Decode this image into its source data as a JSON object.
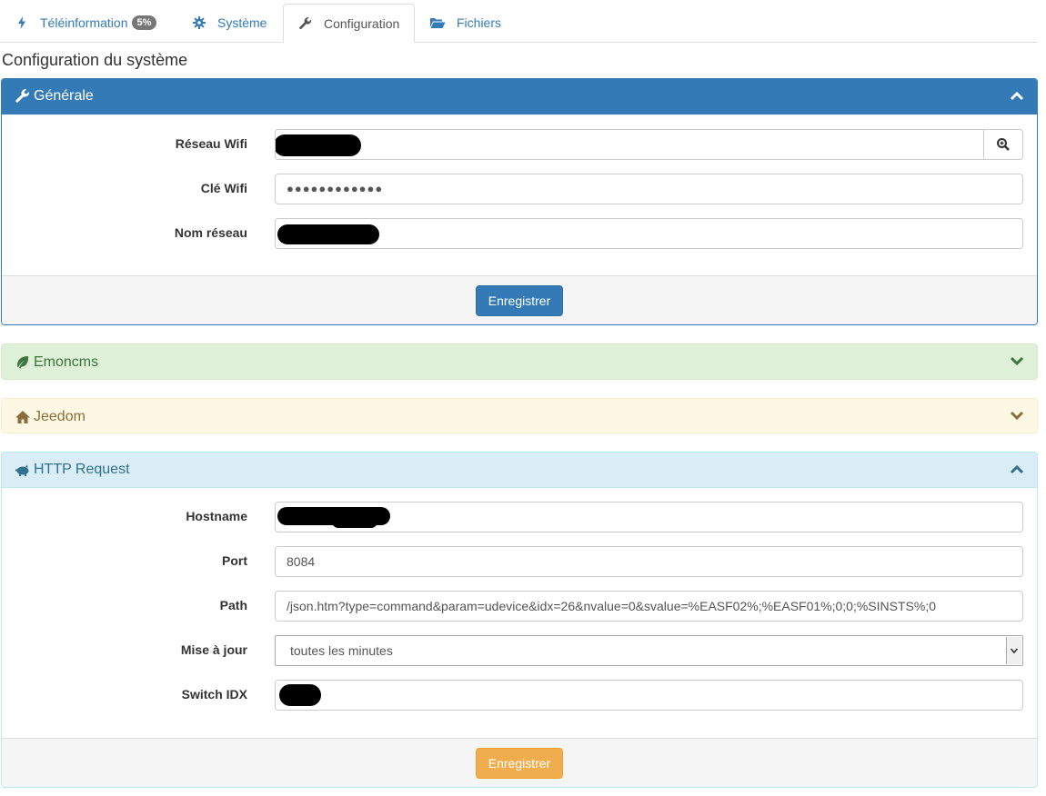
{
  "tabs": [
    {
      "label": "Téléinformation",
      "badge": "5%",
      "icon": "bolt-icon"
    },
    {
      "label": "Système",
      "icon": "gear-icon"
    },
    {
      "label": "Configuration",
      "icon": "wrench-icon",
      "active": true
    },
    {
      "label": "Fichiers",
      "icon": "folder-open-icon"
    }
  ],
  "page_title": "Configuration du système",
  "general": {
    "title": "Générale",
    "wifi_label": "Réseau Wifi",
    "key_label": "Clé Wifi",
    "key_value": "●●●●●●●●●●●●",
    "netname_label": "Nom réseau",
    "save_label": "Enregistrer"
  },
  "emoncms": {
    "title": "Emoncms"
  },
  "jeedom": {
    "title": "Jeedom"
  },
  "http": {
    "title": "HTTP Request",
    "hostname_label": "Hostname",
    "port_label": "Port",
    "port_value": "8084",
    "path_label": "Path",
    "path_value": "/json.htm?type=command&param=udevice&idx=26&nvalue=0&svalue=%EASF02%;%EASF01%;0;0;%SINSTS%;0",
    "update_label": "Mise à jour",
    "update_value": "toutes les minutes",
    "switch_label": "Switch IDX",
    "save_label": "Enregistrer"
  },
  "colors": {
    "primary": "#337ab7",
    "success": "#dff0d8",
    "warning": "#fcf8e3",
    "info": "#d9edf7",
    "btn_warning": "#f0ad4e"
  }
}
